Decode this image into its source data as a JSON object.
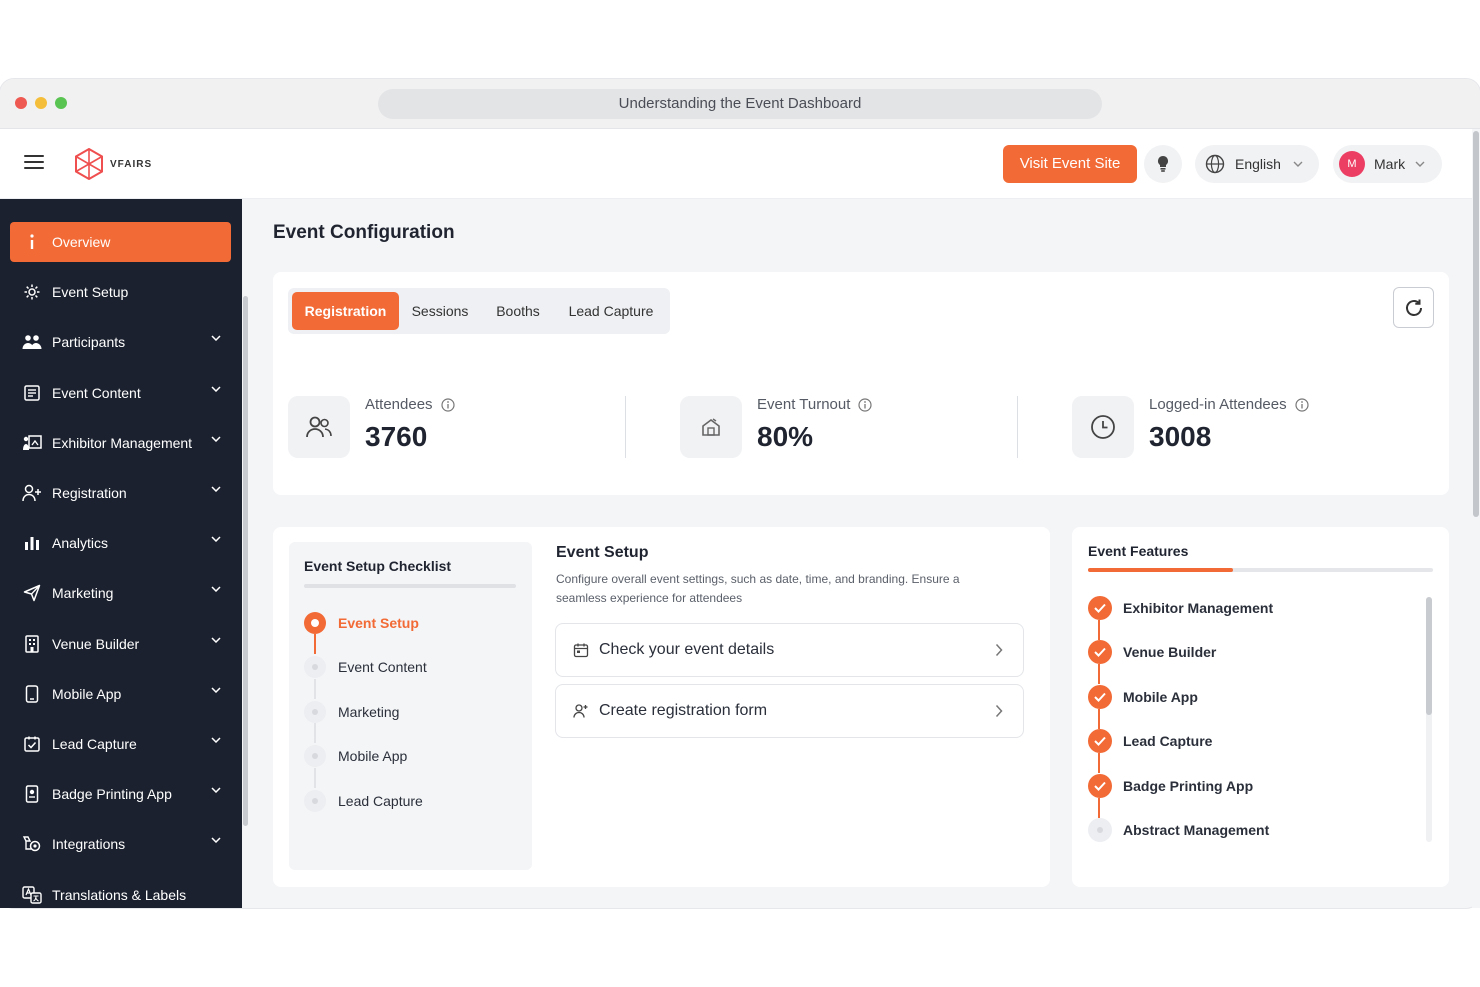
{
  "window": {
    "title": "Understanding the Event Dashboard"
  },
  "header": {
    "logo_text": "VFAIRS",
    "visit_button": "Visit Event Site",
    "language": "English",
    "user": {
      "initial": "M",
      "name": "Mark"
    }
  },
  "sidebar": {
    "items": [
      {
        "label": "Overview",
        "icon": "info-icon",
        "active": true
      },
      {
        "label": "Event Setup",
        "icon": "gear-icon"
      },
      {
        "label": "Participants",
        "icon": "users-icon"
      },
      {
        "label": "Event Content",
        "icon": "content-icon"
      },
      {
        "label": "Exhibitor Management",
        "icon": "exhibitor-icon"
      },
      {
        "label": "Registration",
        "icon": "user-plus-icon"
      },
      {
        "label": "Analytics",
        "icon": "bar-chart-icon"
      },
      {
        "label": "Marketing",
        "icon": "paper-plane-icon"
      },
      {
        "label": "Venue Builder",
        "icon": "building-icon"
      },
      {
        "label": "Mobile App",
        "icon": "phone-icon"
      },
      {
        "label": "Lead Capture",
        "icon": "lead-capture-icon"
      },
      {
        "label": "Badge Printing App",
        "icon": "badge-icon"
      },
      {
        "label": "Integrations",
        "icon": "integrations-icon"
      },
      {
        "label": "Translations & Labels",
        "icon": "translate-icon"
      }
    ]
  },
  "main": {
    "title": "Event Configuration",
    "tabs": [
      "Registration",
      "Sessions",
      "Booths",
      "Lead Capture"
    ],
    "stats": [
      {
        "label": "Attendees",
        "value": "3760",
        "icon": "users-icon"
      },
      {
        "label": "Event Turnout",
        "value": "80%",
        "icon": "turnout-icon"
      },
      {
        "label": "Logged-in Attendees",
        "value": "3008",
        "icon": "clock-icon"
      }
    ],
    "checklist": {
      "title": "Event Setup Checklist",
      "items": [
        "Event Setup",
        "Event Content",
        "Marketing",
        "Mobile App",
        "Lead Capture"
      ]
    },
    "event_setup": {
      "title": "Event Setup",
      "description": "Configure overall event settings, such as date, time, and branding. Ensure a seamless experience for attendees",
      "actions": [
        "Check your event details",
        "Create registration form"
      ]
    },
    "features": {
      "title": "Event Features",
      "progress": 0.42,
      "items": [
        "Exhibitor Management",
        "Venue Builder",
        "Mobile App",
        "Lead Capture",
        "Badge Printing App",
        "Abstract Management"
      ]
    }
  },
  "colors": {
    "accent": "#f26a35",
    "sidebar": "#1b212e",
    "avatar": "#ec3e63"
  }
}
